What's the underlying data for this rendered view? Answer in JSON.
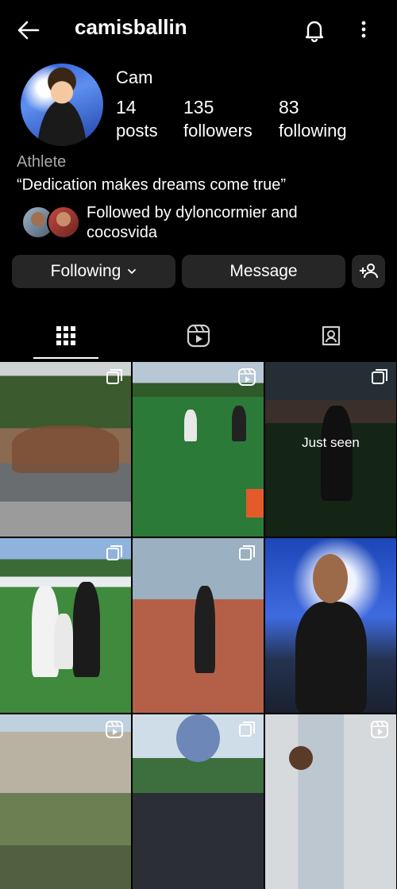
{
  "header": {
    "username": "camisballin",
    "back_icon": "arrow-left-icon",
    "bell_icon": "bell-icon",
    "more_icon": "more-vertical-icon"
  },
  "profile": {
    "display_name": "Cam",
    "stats": [
      {
        "value": "14",
        "label": "posts"
      },
      {
        "value": "135",
        "label": "followers"
      },
      {
        "value": "83",
        "label": "following"
      }
    ],
    "category": "Athlete",
    "bio": "“Dedication makes dreams come true”",
    "followed_by": "Followed by dyloncormier and cocosvida"
  },
  "actions": {
    "following_label": "Following",
    "message_label": "Message",
    "add_person_icon": "add-person-icon"
  },
  "tabs": [
    {
      "name": "grid",
      "icon": "grid-icon",
      "active": true
    },
    {
      "name": "reels",
      "icon": "reels-icon",
      "active": false
    },
    {
      "name": "tagged",
      "icon": "tagged-icon",
      "active": false
    }
  ],
  "posts": [
    {
      "badge": "carousel-icon",
      "overlay": ""
    },
    {
      "badge": "reels-icon",
      "overlay": ""
    },
    {
      "badge": "carousel-icon",
      "overlay": "Just seen"
    },
    {
      "badge": "carousel-icon",
      "overlay": ""
    },
    {
      "badge": "carousel-icon",
      "overlay": ""
    },
    {
      "badge": "",
      "overlay": ""
    },
    {
      "badge": "reels-icon",
      "overlay": ""
    },
    {
      "badge": "carousel-icon",
      "overlay": ""
    },
    {
      "badge": "reels-icon",
      "overlay": ""
    }
  ],
  "colors": {
    "background": "#000000",
    "button": "#262626",
    "text": "#ffffff",
    "secondary_text": "#a8a8a8"
  }
}
